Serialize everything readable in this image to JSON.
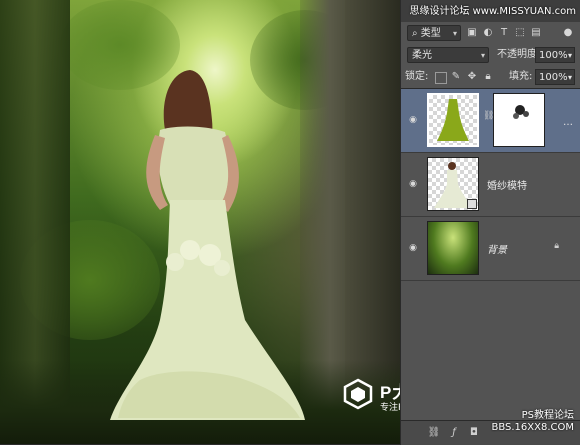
{
  "app": {
    "site_top": "思缘设计论坛 www.MISSYUAN.com",
    "site_bottom_line1": "PS教程论坛",
    "site_bottom_line2": "BBS.16XX8.COM"
  },
  "watermark": {
    "title": "P大点S",
    "subtitle": "专注Photoshop教程"
  },
  "layers_panel": {
    "filter_kind": "类型",
    "blend_mode": "柔光",
    "opacity_label": "不透明度:",
    "opacity_value": "100%",
    "lock_label": "锁定:",
    "fill_label": "填充:",
    "fill_value": "100%",
    "layers": [
      {
        "name": "",
        "selected": true,
        "has_mask": true
      },
      {
        "name": "婚纱模特",
        "selected": false,
        "smart_object": true
      },
      {
        "name": "背景",
        "selected": false,
        "locked": true
      }
    ]
  },
  "icons": {
    "eye": "eye-icon",
    "lock": "lock-icon",
    "link": "chain-icon"
  },
  "colors": {
    "panel_bg": "#535353",
    "selected_layer": "#5f6f8a",
    "dress_thumb_green": "#8aa81a"
  }
}
